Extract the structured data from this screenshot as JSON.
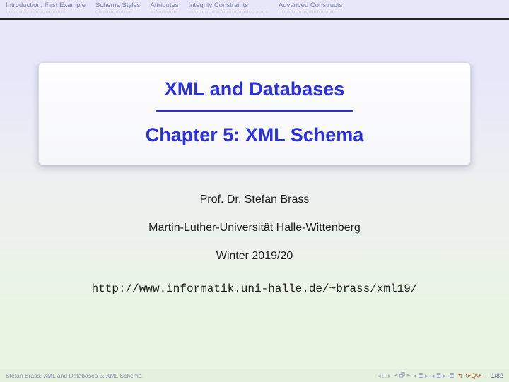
{
  "nav": [
    {
      "title": "Introduction, First Example",
      "dots": "○○○○○○○○○○○○○○○○○○"
    },
    {
      "title": "Schema Styles",
      "dots": "○○○○○○○○○○○"
    },
    {
      "title": "Attributes",
      "dots": "○○○○○○○○"
    },
    {
      "title": "Integrity Constraints",
      "dots": "○○○○○○○○○○○○○○○○○○○○○○○○"
    },
    {
      "title": "Advanced Constructs",
      "dots": "○○○○○○○○○○○○○○○○○"
    }
  ],
  "title": {
    "main": "XML and Databases",
    "sub": "Chapter 5: XML Schema"
  },
  "author": "Prof. Dr. Stefan Brass",
  "institution": "Martin-Luther-Universität Halle-Wittenberg",
  "term": "Winter 2019/20",
  "url": "http://www.informatik.uni-halle.de/~brass/xml19/",
  "footer": {
    "left": "Stefan Brass:   XML and Databases  5. XML Schema",
    "page": "1/82"
  },
  "icons": {
    "first": "◂ □ ▸",
    "prev": "◂ 🗗 ▸",
    "next1": "◂ ≣ ▸",
    "next2": "◂ ≣ ▸",
    "mode": "≣",
    "back": "↰",
    "loop": "⟳ Q ⟳"
  }
}
